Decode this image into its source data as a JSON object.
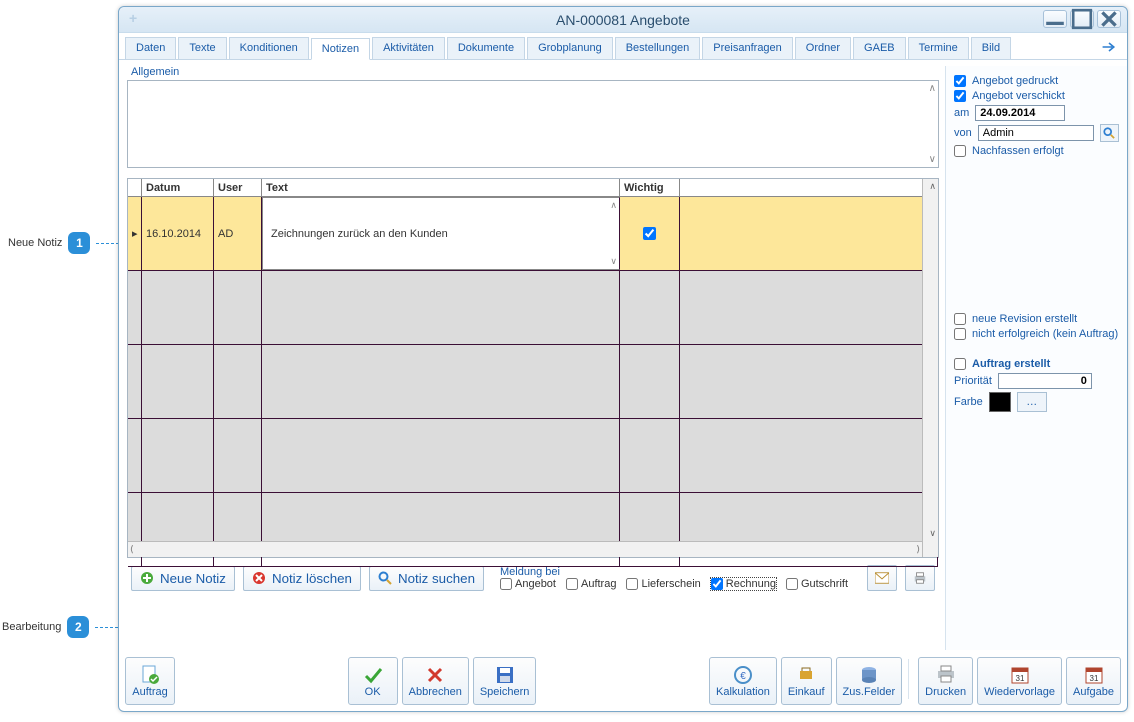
{
  "window": {
    "title": "AN-000081 Angebote"
  },
  "tabs": [
    "Daten",
    "Texte",
    "Konditionen",
    "Notizen",
    "Aktivitäten",
    "Dokumente",
    "Grobplanung",
    "Bestellungen",
    "Preisanfragen",
    "Ordner",
    "GAEB",
    "Termine",
    "Bild"
  ],
  "active_tab_index": 3,
  "allgemein_label": "Allgemein",
  "grid": {
    "headers": {
      "datum": "Datum",
      "user": "User",
      "text": "Text",
      "wichtig": "Wichtig"
    },
    "row": {
      "datum": "16.10.2014",
      "user": "AD",
      "text": "Zeichnungen zurück an den Kunden",
      "wichtig": true
    }
  },
  "toolbar": {
    "neue": "Neue Notiz",
    "loeschen": "Notiz löschen",
    "suchen": "Notiz suchen",
    "meldung_label": "Meldung bei",
    "opts": {
      "angebot": "Angebot",
      "auftrag": "Auftrag",
      "lieferschein": "Lieferschein",
      "rechnung": "Rechnung",
      "gutschrift": "Gutschrift"
    },
    "opts_state": {
      "angebot": false,
      "auftrag": false,
      "lieferschein": false,
      "rechnung": true,
      "gutschrift": false
    }
  },
  "side": {
    "gedruckt": "Angebot gedruckt",
    "verschickt": "Angebot verschickt",
    "am_label": "am",
    "am_value": "24.09.2014",
    "von_label": "von",
    "von_value": "Admin",
    "nachfassen": "Nachfassen erfolgt",
    "revision": "neue Revision erstellt",
    "nicht_erf": "nicht erfolgreich (kein Auftrag)",
    "auftrag_erst": "Auftrag erstellt",
    "prio_label": "Priorität",
    "prio_value": "0",
    "farbe_label": "Farbe",
    "farbe_value": "#000000"
  },
  "bottom": {
    "auftrag": "Auftrag",
    "ok": "OK",
    "abbrechen": "Abbrechen",
    "speichern": "Speichern",
    "kalkulation": "Kalkulation",
    "einkauf": "Einkauf",
    "zusfelder": "Zus.Felder",
    "drucken": "Drucken",
    "wiedervorlage": "Wiedervorlage",
    "aufgabe": "Aufgabe"
  },
  "annotations": {
    "a1": "Neue Notiz",
    "a2": "Bearbeitung",
    "n1": "1",
    "n2": "2"
  }
}
